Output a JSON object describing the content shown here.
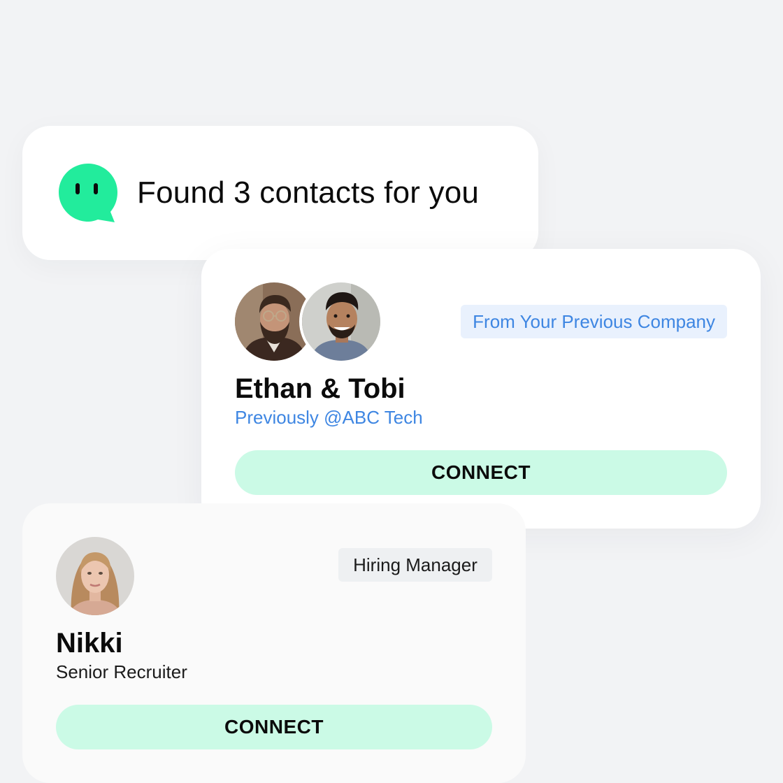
{
  "notification": {
    "icon": "chat-bubble-bot-icon",
    "text": "Found 3 contacts for you"
  },
  "contacts": [
    {
      "tag": "From Your Previous Company",
      "name": "Ethan & Tobi",
      "subtitle": "Previously @ABC Tech",
      "button": "CONNECT",
      "avatars": [
        "ethan-avatar",
        "tobi-avatar"
      ]
    },
    {
      "tag": "Hiring Manager",
      "name": "Nikki",
      "subtitle": "Senior Recruiter",
      "button": "CONNECT",
      "avatars": [
        "nikki-avatar"
      ]
    }
  ],
  "colors": {
    "background": "#f2f3f5",
    "accent_green": "#22ec9c",
    "button_bg": "#cbfae6",
    "link_blue": "#3e86e2",
    "tag_blue_bg": "#e9f1fd"
  }
}
